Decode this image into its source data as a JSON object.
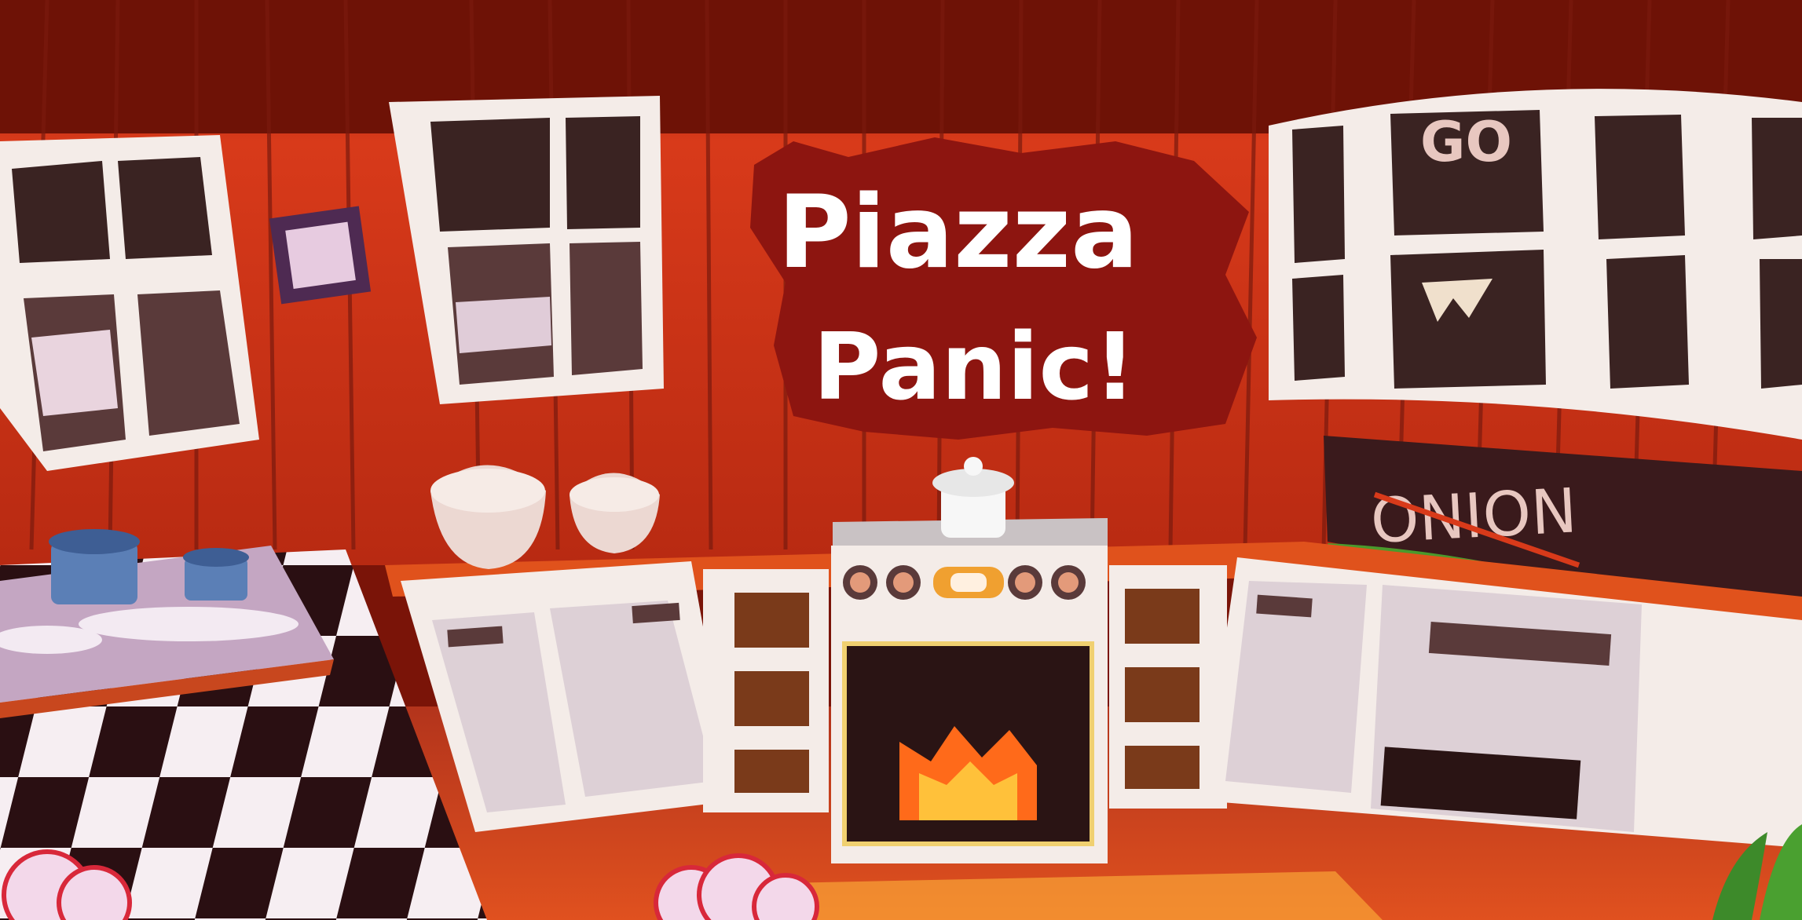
{
  "game": {
    "title_line1": "Piazza",
    "title_line2": "Panic!",
    "wall_sign": "ONION",
    "cabinet_face": "GO"
  },
  "colors": {
    "wall_red": "#d2351a",
    "wall_dark": "#6e1206",
    "title_badge": "#8d1510",
    "cabinet_white": "#f4ece8",
    "floor_dark": "#2a0f12",
    "floor_light": "#f6eef2",
    "fire_orange": "#ff6a1a",
    "fire_yellow": "#ffc13a",
    "pot_blue": "#5b7fb6"
  }
}
